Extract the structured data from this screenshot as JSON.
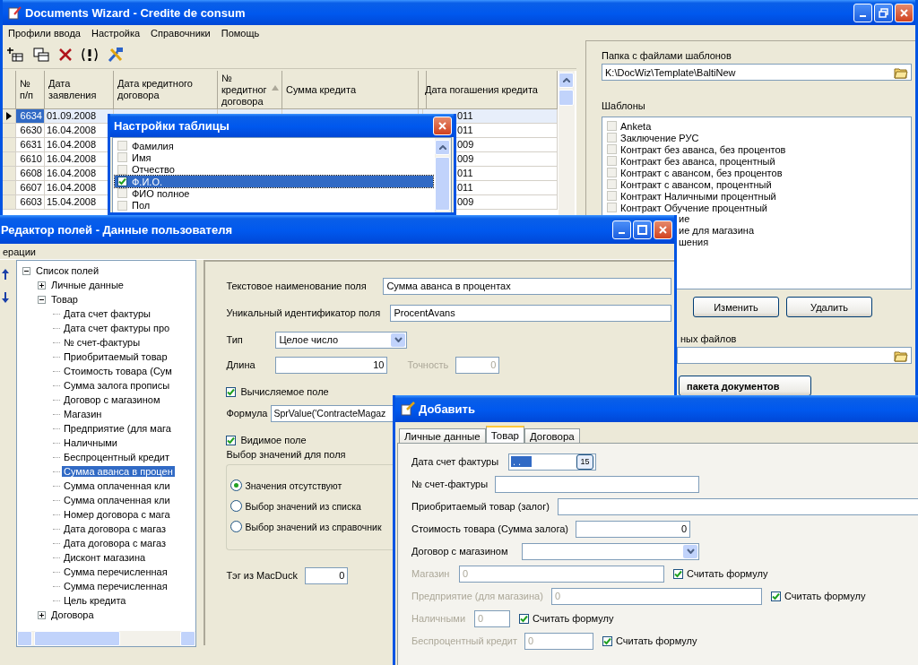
{
  "main_window": {
    "title": "Documents Wizard - Credite de consum",
    "menu": [
      "Профили ввода",
      "Настройка",
      "Справочники",
      "Помощь"
    ],
    "table": {
      "columns": [
        {
          "label": "№ п/п",
          "sorted": false
        },
        {
          "label": "Дата заявления",
          "sorted": false
        },
        {
          "label": "Дата кредитного договора",
          "sorted": false
        },
        {
          "label": "№ кредитног договора",
          "sorted": true
        },
        {
          "label": "Сумма кредита",
          "sorted": false
        },
        {
          "label": "Дата погашения кредита",
          "sorted": false
        }
      ],
      "rows": [
        {
          "number": "6634",
          "date": "01.09.2008",
          "tail": "011",
          "selected": true
        },
        {
          "number": "6630",
          "date": "16.04.2008",
          "tail": "011",
          "selected": false
        },
        {
          "number": "6631",
          "date": "16.04.2008",
          "tail": "009",
          "selected": false
        },
        {
          "number": "6610",
          "date": "16.04.2008",
          "tail": "009",
          "selected": false
        },
        {
          "number": "6608",
          "date": "16.04.2008",
          "tail": "011",
          "selected": false
        },
        {
          "number": "6607",
          "date": "16.04.2008",
          "tail": "011",
          "selected": false
        },
        {
          "number": "6603",
          "date": "15.04.2008",
          "tail": "009",
          "selected": false
        }
      ]
    },
    "template_folder": {
      "label": "Папка с файлами шаблонов",
      "value": "K:\\DocWiz\\Template\\BaltiNew"
    },
    "templates": {
      "label": "Шаблоны",
      "items": [
        {
          "label": "Anketa",
          "checked": false
        },
        {
          "label": "Заключение РУС",
          "checked": false
        },
        {
          "label": "Контракт без аванса, без процентов",
          "checked": false
        },
        {
          "label": "Контракт без аванса, процентный",
          "checked": false
        },
        {
          "label": "Контракт с авансом, без процентов",
          "checked": false
        },
        {
          "label": "Контракт с авансом, процентный",
          "checked": false
        },
        {
          "label": "Контракт Наличными процентный",
          "checked": false
        },
        {
          "label": "Контракт Обучение процентный",
          "checked": false
        }
      ],
      "fragments": [
        "ие",
        "ие для магазина",
        "шения"
      ]
    },
    "template_buttons": [
      "Изменить",
      "Удалить"
    ],
    "output_folder": {
      "label": "ных файлов"
    },
    "generate_button": "пакета документов"
  },
  "table_settings": {
    "title": "Настройки таблицы",
    "items": [
      {
        "label": "Фамилия",
        "checked": false,
        "selected": false
      },
      {
        "label": "Имя",
        "checked": false,
        "selected": false
      },
      {
        "label": "Отчество",
        "checked": false,
        "selected": false
      },
      {
        "label": "Ф.И.О.",
        "checked": true,
        "selected": true
      },
      {
        "label": "ФИО полное",
        "checked": false,
        "selected": false
      },
      {
        "label": "Пол",
        "checked": false,
        "selected": false
      }
    ]
  },
  "field_editor": {
    "title": "Редактор полей - Данные пользователя",
    "menu": [
      "ерации"
    ],
    "tree": [
      {
        "label": "Список полей",
        "expanded": true,
        "selected": false,
        "children": [
          {
            "label": "Личные данные",
            "expanded": false,
            "selected": false
          },
          {
            "label": "Товар",
            "expanded": true,
            "selected": false,
            "children": [
              {
                "label": "Дата счет фактуры",
                "selected": false
              },
              {
                "label": "Дата счет фактуры про",
                "selected": false
              },
              {
                "label": "№ счет-фактуры",
                "selected": false
              },
              {
                "label": "Приобритаемый товар",
                "selected": false
              },
              {
                "label": "Стоимость товара (Сум",
                "selected": false
              },
              {
                "label": "Сумма залога прописы",
                "selected": false
              },
              {
                "label": "Договор с магазином",
                "selected": false
              },
              {
                "label": "Магазин",
                "selected": false
              },
              {
                "label": "Предприятие (для мага",
                "selected": false
              },
              {
                "label": "Наличными",
                "selected": false
              },
              {
                "label": "Беспроцентный кредит",
                "selected": false
              },
              {
                "label": "Сумма аванса в процен",
                "selected": true
              },
              {
                "label": "Сумма оплаченная кли",
                "selected": false
              },
              {
                "label": "Сумма оплаченная кли",
                "selected": false
              },
              {
                "label": "Номер договора с мага",
                "selected": false
              },
              {
                "label": "Дата договора с магаз",
                "selected": false
              },
              {
                "label": "Дата договора с магаз",
                "selected": false
              },
              {
                "label": "Дисконт магазина",
                "selected": false
              },
              {
                "label": "Сумма перечисленная",
                "selected": false
              },
              {
                "label": "Сумма перечисленная",
                "selected": false
              },
              {
                "label": "Цель кредита",
                "selected": false
              }
            ]
          },
          {
            "label": "Договора",
            "expanded": false,
            "selected": false
          }
        ]
      }
    ],
    "form": {
      "name_label": "Текстовое наименование поля",
      "name_value": "Сумма аванса в процентах",
      "id_label": "Уникальный идентификатор поля",
      "id_value": "ProcentAvans",
      "type_label": "Тип",
      "type_value": "Целое число",
      "length_label": "Длина",
      "length_value": "10",
      "precision_label": "Точность",
      "precision_value": "0",
      "precision_disabled": true,
      "computed": {
        "label": "Вычисляемое поле",
        "checked": true
      },
      "formula_label": "Формула",
      "formula_value": "SprValue('ContracteMagaz",
      "visible": {
        "label": "Видимое поле",
        "checked": true
      },
      "choice_group": {
        "label": "Выбор значений для поля",
        "options": [
          {
            "label": "Значения отсутствуют",
            "selected": true
          },
          {
            "label": "Выбор значений из списка",
            "selected": false
          },
          {
            "label": "Выбор значений из справочник",
            "selected": false
          }
        ]
      },
      "tag_label": "Тэг из MacDuck",
      "tag_value": "0"
    }
  },
  "add_dialog": {
    "title": "Добавить",
    "tabs": [
      {
        "label": "Личные данные",
        "selected": false
      },
      {
        "label": "Товар",
        "selected": true
      },
      {
        "label": "Договора",
        "selected": false
      }
    ],
    "rows": [
      {
        "kind": "date",
        "label": "Дата счет фактуры",
        "value": ". .",
        "button_text": "15",
        "disabled": false
      },
      {
        "kind": "text",
        "label": "№ счет-фактуры",
        "disabled": false
      },
      {
        "kind": "text",
        "label": "Приобритаемый товар (залог)",
        "disabled": false
      },
      {
        "kind": "number",
        "label": "Стоимость товара (Сумма залога)",
        "value": "0",
        "disabled": false
      },
      {
        "kind": "combo",
        "label": "Договор с магазином",
        "disabled": false
      },
      {
        "kind": "formula",
        "label": "Магазин",
        "value": "0",
        "disabled": true,
        "formula": {
          "label": "Считать формулу",
          "checked": true
        }
      },
      {
        "kind": "formula",
        "label": "Предприятие (для магазина)",
        "value": "0",
        "disabled": true,
        "formula": {
          "label": "Считать формулу",
          "checked": true
        }
      },
      {
        "kind": "formula",
        "label": "Наличными",
        "value": "0",
        "disabled": true,
        "formula": {
          "label": "Считать формулу",
          "checked": true
        }
      },
      {
        "kind": "formula",
        "label": "Беспроцентный кредит",
        "value": "0",
        "disabled": true,
        "formula": {
          "label": "Считать формулу",
          "checked": true
        }
      }
    ]
  }
}
